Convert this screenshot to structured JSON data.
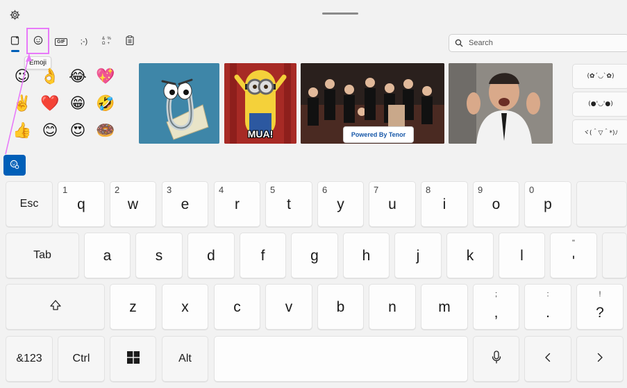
{
  "top": {
    "settings_icon": "gear-icon"
  },
  "tabs": [
    {
      "name": "recent",
      "icon": "heart-clipboard-icon",
      "glyph": ""
    },
    {
      "name": "emoji",
      "icon": "smiley-icon",
      "glyph": "☺"
    },
    {
      "name": "gif",
      "icon": "gif-icon",
      "glyph": "GIF"
    },
    {
      "name": "kaomoji",
      "icon": "kaomoji-icon",
      "glyph": ";-)"
    },
    {
      "name": "symbols",
      "icon": "symbols-icon",
      "glyph": ""
    },
    {
      "name": "clipboard",
      "icon": "clipboard-icon",
      "glyph": ""
    }
  ],
  "tooltip": {
    "text": "Emoji"
  },
  "search": {
    "placeholder": "Search"
  },
  "emojis": [
    "😉",
    "👌",
    "😂",
    "💖",
    "✌️",
    "❤️",
    "😁",
    "🤣",
    "👍",
    "😊",
    "😍",
    "🍩"
  ],
  "gifs": {
    "minion_caption": "MUA!",
    "tenor": "Powered By Tenor"
  },
  "kaomoji": [
    "(✿´◡`✿)",
    "(●'◡'●)",
    "ヾ(＾▽＾*)ﾉ"
  ],
  "keyboard": {
    "row1": [
      {
        "main": "Esc",
        "num": ""
      },
      {
        "main": "q",
        "num": "1"
      },
      {
        "main": "w",
        "num": "2"
      },
      {
        "main": "e",
        "num": "3"
      },
      {
        "main": "r",
        "num": "4"
      },
      {
        "main": "t",
        "num": "5"
      },
      {
        "main": "y",
        "num": "6"
      },
      {
        "main": "u",
        "num": "7"
      },
      {
        "main": "i",
        "num": "8"
      },
      {
        "main": "o",
        "num": "9"
      },
      {
        "main": "p",
        "num": "0"
      }
    ],
    "row2": [
      {
        "main": "Tab"
      },
      {
        "main": "a"
      },
      {
        "main": "s"
      },
      {
        "main": "d"
      },
      {
        "main": "f"
      },
      {
        "main": "g"
      },
      {
        "main": "h"
      },
      {
        "main": "j"
      },
      {
        "main": "k"
      },
      {
        "main": "l"
      },
      {
        "main": "'",
        "alt": "\""
      }
    ],
    "row3": [
      {
        "main": "z"
      },
      {
        "main": "x"
      },
      {
        "main": "c"
      },
      {
        "main": "v"
      },
      {
        "main": "b"
      },
      {
        "main": "n"
      },
      {
        "main": "m"
      },
      {
        "main": ",",
        "alt": ";"
      },
      {
        "main": ".",
        "alt": ":"
      },
      {
        "main": "?",
        "alt": "!"
      }
    ],
    "row4": {
      "symbols": "&123",
      "ctrl": "Ctrl",
      "alt": "Alt"
    }
  },
  "colors": {
    "accent": "#005fb8",
    "highlight": "#e879f9"
  }
}
